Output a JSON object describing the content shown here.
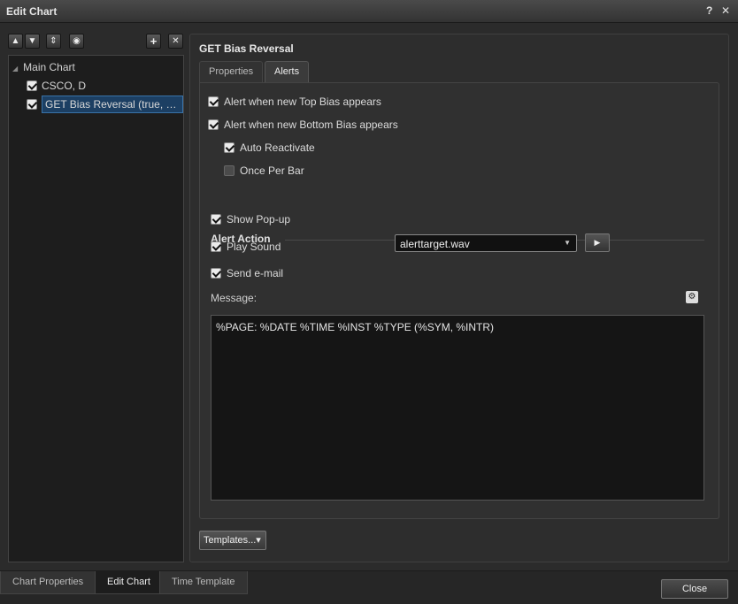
{
  "window": {
    "title": "Edit Chart",
    "help": "?",
    "close": "✕"
  },
  "left": {
    "toolbar": {
      "up": "▲",
      "down": "▼",
      "sort": "⇕",
      "view": "◉",
      "add": "+",
      "remove": "✕"
    },
    "tree": {
      "root": "Main Chart",
      "items": [
        {
          "label": "CSCO, D",
          "checked": true
        },
        {
          "label": "GET Bias Reversal (true, Nor…",
          "checked": true
        }
      ]
    }
  },
  "panel": {
    "title": "GET Bias Reversal",
    "tabs": [
      "Properties",
      "Alerts"
    ],
    "alerts": {
      "top_bias": "Alert when new Top Bias appears",
      "bottom_bias": "Alert when new Bottom Bias appears",
      "auto_reactivate": "Auto Reactivate",
      "once_per_bar": "Once Per Bar",
      "section": "Alert Action",
      "show_popup": "Show Pop-up",
      "play_sound": "Play Sound",
      "sound_file": "alerttarget.wav",
      "send_email": "Send e-mail",
      "message_label": "Message:",
      "message": "%PAGE: %DATE %TIME %INST %TYPE (%SYM, %INTR)"
    },
    "templates_button": "Templates...▾"
  },
  "bottom": {
    "tabs": [
      "Chart Properties",
      "Edit Chart",
      "Time Template"
    ],
    "close": "Close"
  }
}
